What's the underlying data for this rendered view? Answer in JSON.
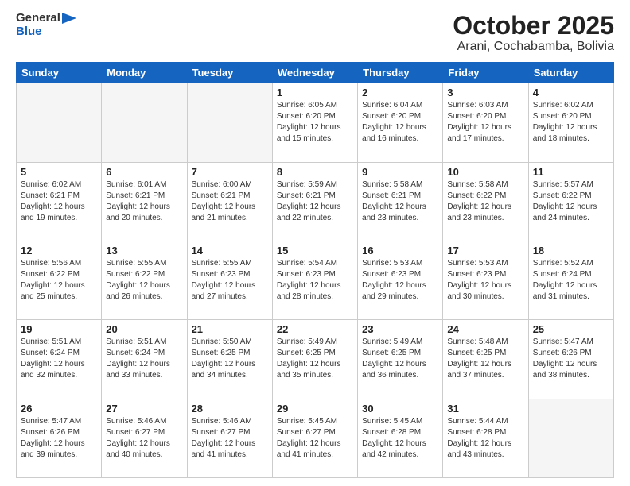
{
  "header": {
    "logo_line1": "General",
    "logo_line2": "Blue",
    "title": "October 2025",
    "subtitle": "Arani, Cochabamba, Bolivia"
  },
  "days_of_week": [
    "Sunday",
    "Monday",
    "Tuesday",
    "Wednesday",
    "Thursday",
    "Friday",
    "Saturday"
  ],
  "weeks": [
    [
      {
        "day": "",
        "info": ""
      },
      {
        "day": "",
        "info": ""
      },
      {
        "day": "",
        "info": ""
      },
      {
        "day": "1",
        "info": "Sunrise: 6:05 AM\nSunset: 6:20 PM\nDaylight: 12 hours\nand 15 minutes."
      },
      {
        "day": "2",
        "info": "Sunrise: 6:04 AM\nSunset: 6:20 PM\nDaylight: 12 hours\nand 16 minutes."
      },
      {
        "day": "3",
        "info": "Sunrise: 6:03 AM\nSunset: 6:20 PM\nDaylight: 12 hours\nand 17 minutes."
      },
      {
        "day": "4",
        "info": "Sunrise: 6:02 AM\nSunset: 6:20 PM\nDaylight: 12 hours\nand 18 minutes."
      }
    ],
    [
      {
        "day": "5",
        "info": "Sunrise: 6:02 AM\nSunset: 6:21 PM\nDaylight: 12 hours\nand 19 minutes."
      },
      {
        "day": "6",
        "info": "Sunrise: 6:01 AM\nSunset: 6:21 PM\nDaylight: 12 hours\nand 20 minutes."
      },
      {
        "day": "7",
        "info": "Sunrise: 6:00 AM\nSunset: 6:21 PM\nDaylight: 12 hours\nand 21 minutes."
      },
      {
        "day": "8",
        "info": "Sunrise: 5:59 AM\nSunset: 6:21 PM\nDaylight: 12 hours\nand 22 minutes."
      },
      {
        "day": "9",
        "info": "Sunrise: 5:58 AM\nSunset: 6:21 PM\nDaylight: 12 hours\nand 23 minutes."
      },
      {
        "day": "10",
        "info": "Sunrise: 5:58 AM\nSunset: 6:22 PM\nDaylight: 12 hours\nand 23 minutes."
      },
      {
        "day": "11",
        "info": "Sunrise: 5:57 AM\nSunset: 6:22 PM\nDaylight: 12 hours\nand 24 minutes."
      }
    ],
    [
      {
        "day": "12",
        "info": "Sunrise: 5:56 AM\nSunset: 6:22 PM\nDaylight: 12 hours\nand 25 minutes."
      },
      {
        "day": "13",
        "info": "Sunrise: 5:55 AM\nSunset: 6:22 PM\nDaylight: 12 hours\nand 26 minutes."
      },
      {
        "day": "14",
        "info": "Sunrise: 5:55 AM\nSunset: 6:23 PM\nDaylight: 12 hours\nand 27 minutes."
      },
      {
        "day": "15",
        "info": "Sunrise: 5:54 AM\nSunset: 6:23 PM\nDaylight: 12 hours\nand 28 minutes."
      },
      {
        "day": "16",
        "info": "Sunrise: 5:53 AM\nSunset: 6:23 PM\nDaylight: 12 hours\nand 29 minutes."
      },
      {
        "day": "17",
        "info": "Sunrise: 5:53 AM\nSunset: 6:23 PM\nDaylight: 12 hours\nand 30 minutes."
      },
      {
        "day": "18",
        "info": "Sunrise: 5:52 AM\nSunset: 6:24 PM\nDaylight: 12 hours\nand 31 minutes."
      }
    ],
    [
      {
        "day": "19",
        "info": "Sunrise: 5:51 AM\nSunset: 6:24 PM\nDaylight: 12 hours\nand 32 minutes."
      },
      {
        "day": "20",
        "info": "Sunrise: 5:51 AM\nSunset: 6:24 PM\nDaylight: 12 hours\nand 33 minutes."
      },
      {
        "day": "21",
        "info": "Sunrise: 5:50 AM\nSunset: 6:25 PM\nDaylight: 12 hours\nand 34 minutes."
      },
      {
        "day": "22",
        "info": "Sunrise: 5:49 AM\nSunset: 6:25 PM\nDaylight: 12 hours\nand 35 minutes."
      },
      {
        "day": "23",
        "info": "Sunrise: 5:49 AM\nSunset: 6:25 PM\nDaylight: 12 hours\nand 36 minutes."
      },
      {
        "day": "24",
        "info": "Sunrise: 5:48 AM\nSunset: 6:25 PM\nDaylight: 12 hours\nand 37 minutes."
      },
      {
        "day": "25",
        "info": "Sunrise: 5:47 AM\nSunset: 6:26 PM\nDaylight: 12 hours\nand 38 minutes."
      }
    ],
    [
      {
        "day": "26",
        "info": "Sunrise: 5:47 AM\nSunset: 6:26 PM\nDaylight: 12 hours\nand 39 minutes."
      },
      {
        "day": "27",
        "info": "Sunrise: 5:46 AM\nSunset: 6:27 PM\nDaylight: 12 hours\nand 40 minutes."
      },
      {
        "day": "28",
        "info": "Sunrise: 5:46 AM\nSunset: 6:27 PM\nDaylight: 12 hours\nand 41 minutes."
      },
      {
        "day": "29",
        "info": "Sunrise: 5:45 AM\nSunset: 6:27 PM\nDaylight: 12 hours\nand 41 minutes."
      },
      {
        "day": "30",
        "info": "Sunrise: 5:45 AM\nSunset: 6:28 PM\nDaylight: 12 hours\nand 42 minutes."
      },
      {
        "day": "31",
        "info": "Sunrise: 5:44 AM\nSunset: 6:28 PM\nDaylight: 12 hours\nand 43 minutes."
      },
      {
        "day": "",
        "info": ""
      }
    ]
  ]
}
